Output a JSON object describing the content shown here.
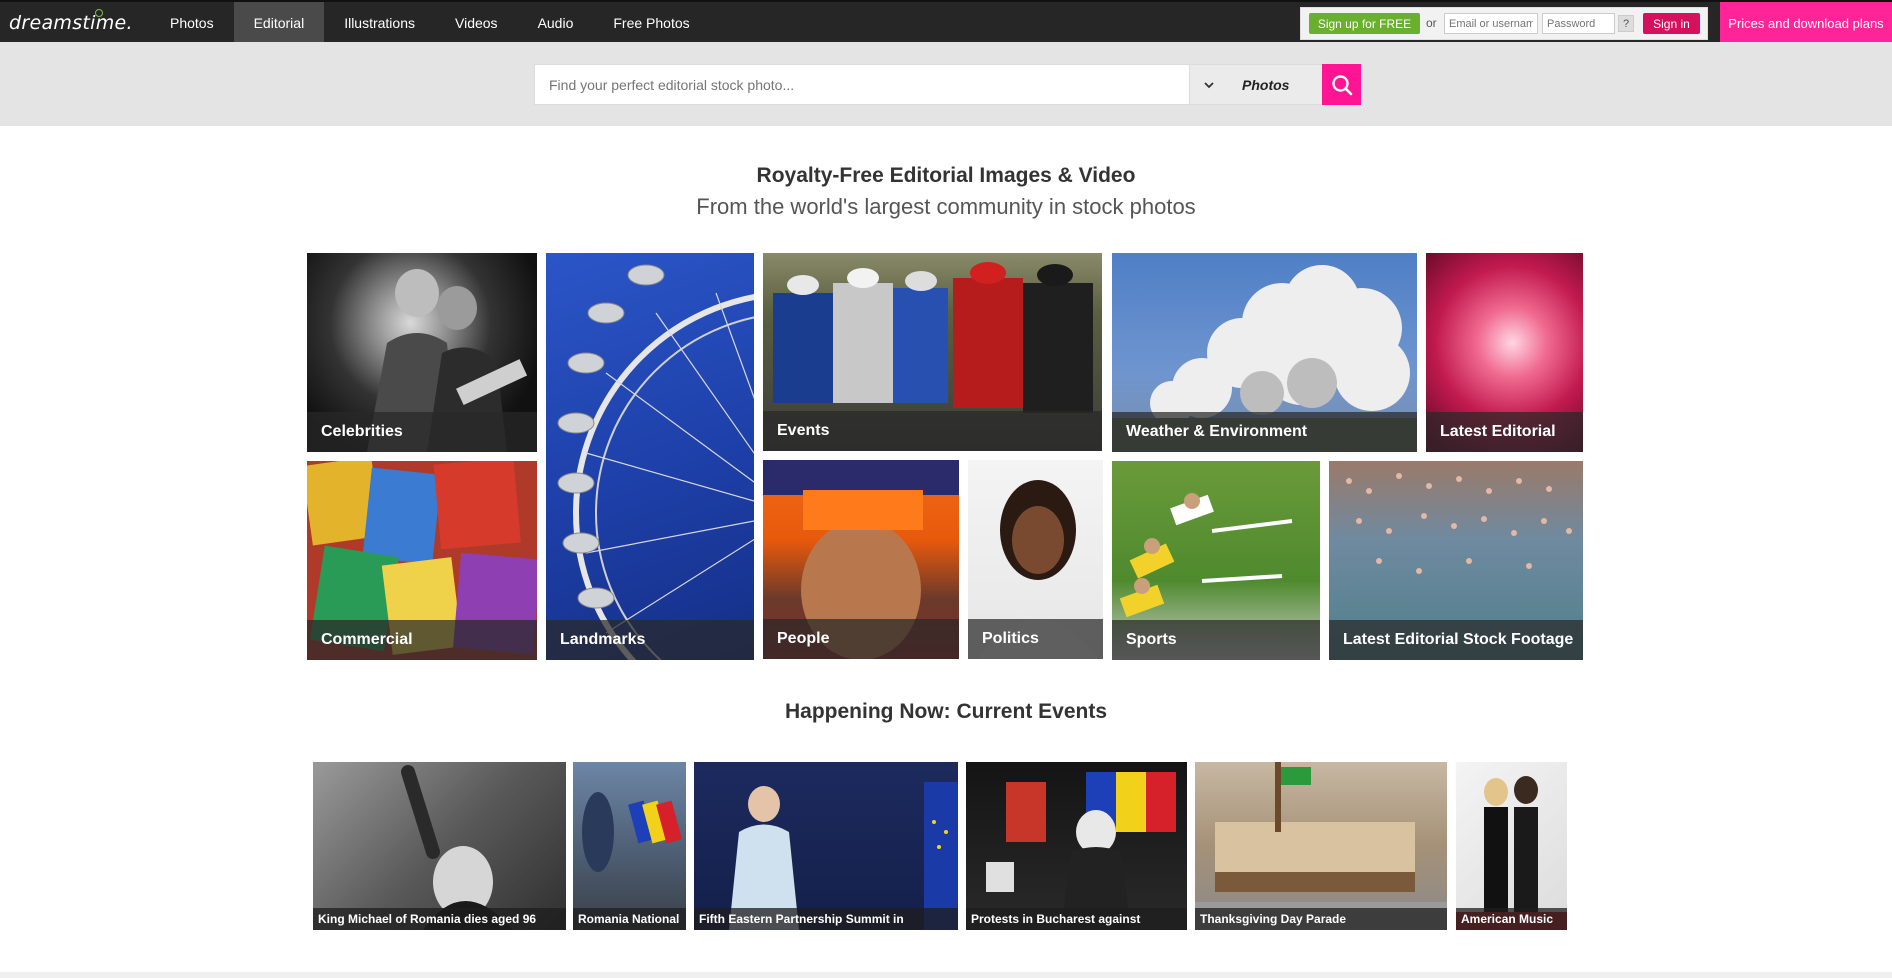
{
  "brand": {
    "logo_text": "dreamstime."
  },
  "nav": {
    "items": [
      {
        "label": "Photos",
        "active": false
      },
      {
        "label": "Editorial",
        "active": true
      },
      {
        "label": "Illustrations",
        "active": false
      },
      {
        "label": "Videos",
        "active": false
      },
      {
        "label": "Audio",
        "active": false
      },
      {
        "label": "Free Photos",
        "active": false
      }
    ]
  },
  "auth": {
    "signup_label": "Sign up for FREE",
    "or_label": "or",
    "email_placeholder": "Email or username",
    "password_placeholder": "Password",
    "help_label": "?",
    "signin_label": "Sign in"
  },
  "prices_label": "Prices and download plans",
  "search": {
    "placeholder": "Find your perfect editorial stock photo...",
    "type_label": "Photos"
  },
  "headings": {
    "title": "Royalty-Free Editorial Images & Video",
    "subtitle": "From the world's largest community in stock photos",
    "current_events": "Happening Now: Current Events"
  },
  "categories": [
    {
      "label": "Celebrities"
    },
    {
      "label": "Landmarks"
    },
    {
      "label": "Events"
    },
    {
      "label": "Weather & Environment"
    },
    {
      "label": "Latest Editorial"
    },
    {
      "label": "Commercial"
    },
    {
      "label": "People"
    },
    {
      "label": "Politics"
    },
    {
      "label": "Sports"
    },
    {
      "label": "Latest Editorial Stock Footage"
    }
  ],
  "events": [
    {
      "caption": "King Michael of Romania dies aged 96"
    },
    {
      "caption": "Romania National"
    },
    {
      "caption": "Fifth Eastern Partnership Summit in"
    },
    {
      "caption": "Protests in Bucharest against"
    },
    {
      "caption": "Thanksgiving Day Parade"
    },
    {
      "caption": "American Music"
    }
  ],
  "colors": {
    "topbar": "#262626",
    "signup": "#6ab02e",
    "signin": "#d5115f",
    "prices": "#ff2497",
    "search_button": "#ff1493"
  }
}
